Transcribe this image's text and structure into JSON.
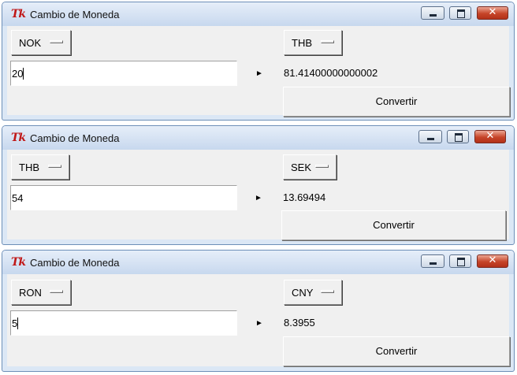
{
  "windows": [
    {
      "title": "Cambio de Moneda",
      "icon_text": "Tk",
      "from_currency": "NOK",
      "to_currency": "THB",
      "amount": "20",
      "amount_has_caret": true,
      "arrow": "►",
      "result": "81.41400000000002",
      "convert_label": "Convertir",
      "close_glyph": "✕"
    },
    {
      "title": "Cambio de Moneda",
      "icon_text": "Tk",
      "from_currency": "THB",
      "to_currency": "SEK",
      "amount": "54",
      "amount_has_caret": false,
      "arrow": "►",
      "result": "13.69494",
      "convert_label": "Convertir",
      "close_glyph": "✕"
    },
    {
      "title": "Cambio de Moneda",
      "icon_text": "Tk",
      "from_currency": "RON",
      "to_currency": "CNY",
      "amount": "5",
      "amount_has_caret": true,
      "arrow": "►",
      "result": "8.3955",
      "convert_label": "Convertir",
      "close_glyph": "✕"
    }
  ],
  "colors": {
    "titlebar": "#c7d8ee",
    "client_bg": "#f0f0f0",
    "close_button": "#c64428",
    "tk_icon": "#c01818"
  },
  "icons": {
    "app": "tk-feather-icon",
    "minimize": "minimize-icon",
    "maximize": "maximize-icon",
    "close": "close-icon",
    "menu_indicator": "option-menu-indicator-icon",
    "arrow": "right-arrow-icon"
  }
}
